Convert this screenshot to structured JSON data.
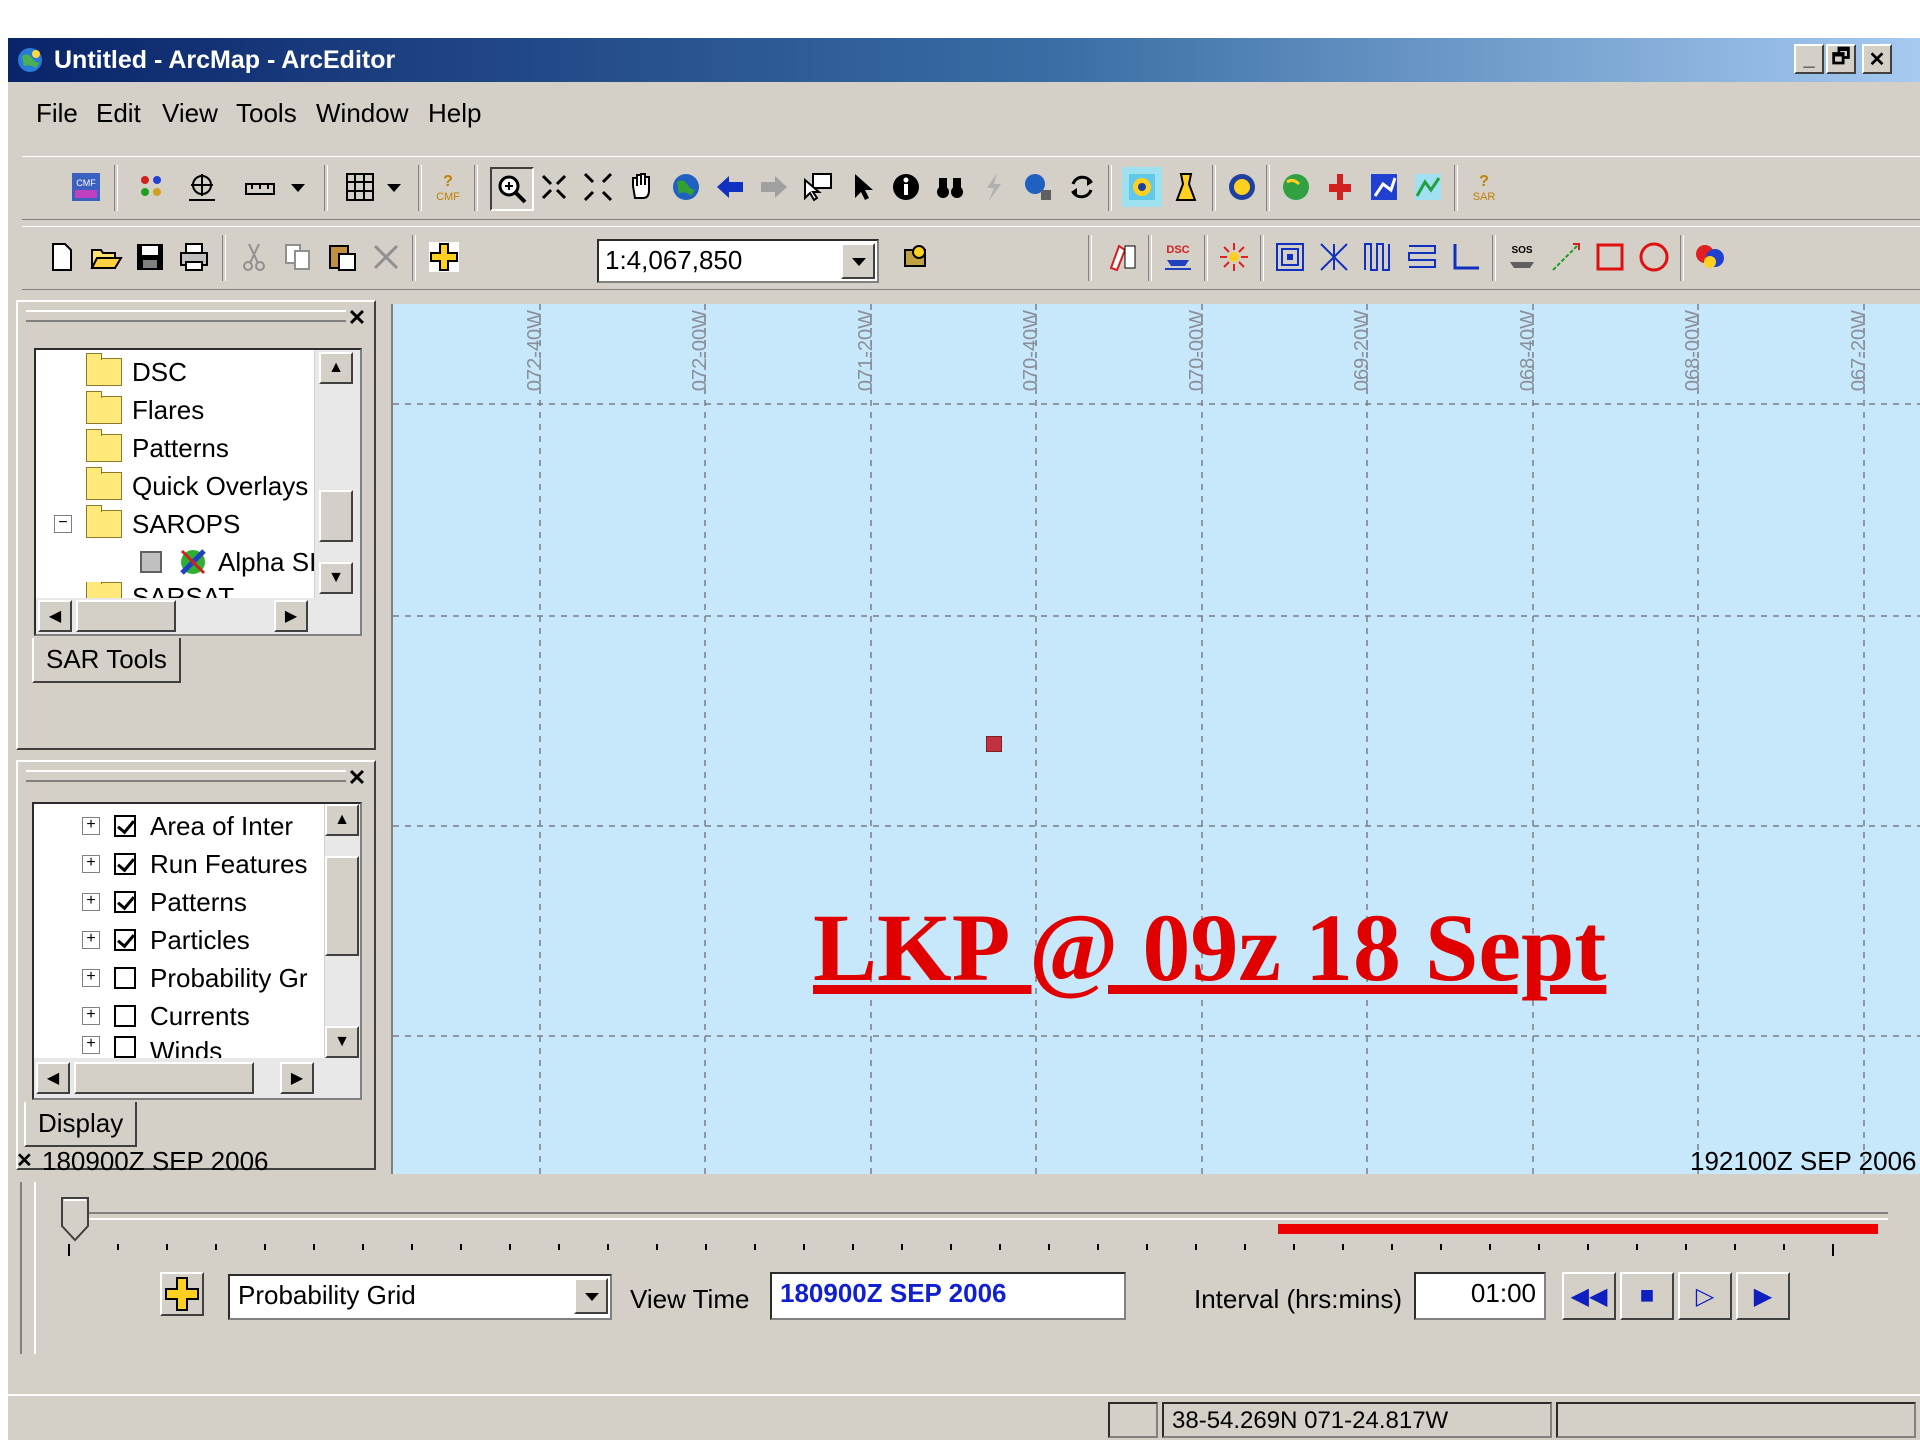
{
  "window": {
    "title": "Untitled - ArcMap - ArcEditor",
    "controls": [
      "_",
      "🗗",
      "✕"
    ]
  },
  "menu": [
    "File",
    "Edit",
    "View",
    "Tools",
    "Window",
    "Help"
  ],
  "toolbar": {
    "cmf_label": "CMF",
    "sar_label": "SAR",
    "scale_value": "1:4,067,850",
    "dsc_label": "DSC",
    "sos_label": "SOS"
  },
  "sar_tools_panel": {
    "tree_items": [
      "DSC",
      "Flares",
      "Patterns",
      "Quick Overlays",
      "SAROPS",
      "Alpha SI",
      "SARSAT"
    ],
    "tab_label": "SAR Tools"
  },
  "display_panel": {
    "layers": [
      {
        "name": "Area of Inter",
        "checked": true
      },
      {
        "name": "Run Features",
        "checked": true
      },
      {
        "name": "Patterns",
        "checked": true
      },
      {
        "name": "Particles",
        "checked": true
      },
      {
        "name": "Probability Gr",
        "checked": false
      },
      {
        "name": "Currents",
        "checked": false
      },
      {
        "name": "Winds",
        "checked": false
      }
    ],
    "tab_label": "Display"
  },
  "map": {
    "longitude_labels": [
      "072-40W",
      "072-00W",
      "071-20W",
      "070-40W",
      "070-00W",
      "069-20W",
      "068-40W",
      "068-00W",
      "067-20W"
    ],
    "annotation": "LKP @ 09z 18 Sept",
    "background_color": "#c7e7fa",
    "annotation_color": "#e00000"
  },
  "time_panel": {
    "start_time": "180900Z SEP 2006",
    "end_time": "192100Z SEP 2006",
    "layer_select": "Probability Grid",
    "view_time_label": "View Time",
    "view_time_value": "180900Z SEP 2006",
    "interval_label": "Interval (hrs:mins)",
    "interval_value": "01:00",
    "slider_position_fraction": 0.0
  },
  "status": {
    "coordinates": "38-54.269N 071-24.817W"
  }
}
